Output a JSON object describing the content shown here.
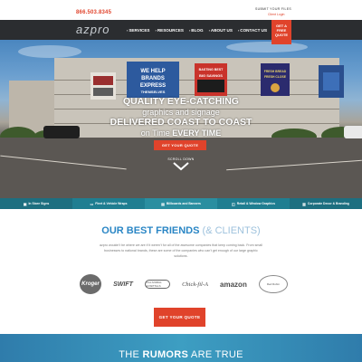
{
  "topbar": {
    "phone": "866.503.8345",
    "submit_label": "SUBMIT YOUR FILES",
    "login_label": "Client Login"
  },
  "nav": {
    "logo_text": "azpro",
    "items": [
      {
        "label": "SERVICES"
      },
      {
        "label": "RESOURCES"
      },
      {
        "label": "BLOG"
      },
      {
        "label": "ABOUT US"
      },
      {
        "label": "CONTACT US"
      }
    ],
    "free_quote_lines": [
      "GET A",
      "FREE",
      "QUOTE"
    ]
  },
  "hero": {
    "line1": "QUALITY EYE-CATCHING",
    "line2": "graphics and signage",
    "line3": "DELIVERED COAST TO COAST",
    "line4_pre": "on Time ",
    "line4_bold": "EVERY TIME",
    "cta_label": "GET YOUR QUOTE",
    "scroll_label": "SCROLL DOWN",
    "billboards": [
      {
        "text": "WE HELP BRANDS EXPRESS THEMSELVES",
        "color": "#2d5a9e"
      },
      {
        "text": "BASTING BEST BIG SAVINGS",
        "color": "#c9332b"
      },
      {
        "text": "FRESH BREAD FRESH CLOSE",
        "color": "#2b2b6e"
      },
      {
        "text": "",
        "color": "#2a4f8e"
      }
    ]
  },
  "services": [
    {
      "label": "In Store Signs",
      "icon": "store-icon",
      "color": "#1d6f80"
    },
    {
      "label": "Fleet & Vehicle Wraps",
      "icon": "truck-icon",
      "color": "#1f7e91"
    },
    {
      "label": "Billboards and Banners",
      "icon": "billboard-icon",
      "color": "#2a8ea0"
    },
    {
      "label": "Retail & Window Graphics",
      "icon": "window-icon",
      "color": "#1f7e91"
    },
    {
      "label": "Corporate Decor & Branding",
      "icon": "building-icon",
      "color": "#1d6f80"
    }
  ],
  "friends": {
    "title_main": "OUR BEST FRIENDS",
    "title_sub": " (& CLIENTS)",
    "description": "azpro wouldn't be where we are if it weren't for all of the awesome companies that keep coming back. From small businesses to national brands, these are some of the companies who can't get enough of our large graphic solutions.",
    "logos": [
      {
        "name": "kroger",
        "text": "Kroger"
      },
      {
        "name": "swift",
        "text": "SWIFT"
      },
      {
        "name": "vet",
        "text": "VCA ANIMAL HOSPITALS"
      },
      {
        "name": "chick",
        "text": "Chick-fil-A"
      },
      {
        "name": "amazon",
        "text": "amazon"
      },
      {
        "name": "redlobster",
        "text": "Red Robin"
      }
    ],
    "cta_label": "GET YOUR QUOTE"
  },
  "rumors": {
    "pre": "THE ",
    "bold": "RUMORS",
    "post": " ARE TRUE"
  },
  "colors": {
    "accent": "#e0432b",
    "nav_bg": "#2b2d30",
    "heading_blue": "#2a86c5"
  }
}
